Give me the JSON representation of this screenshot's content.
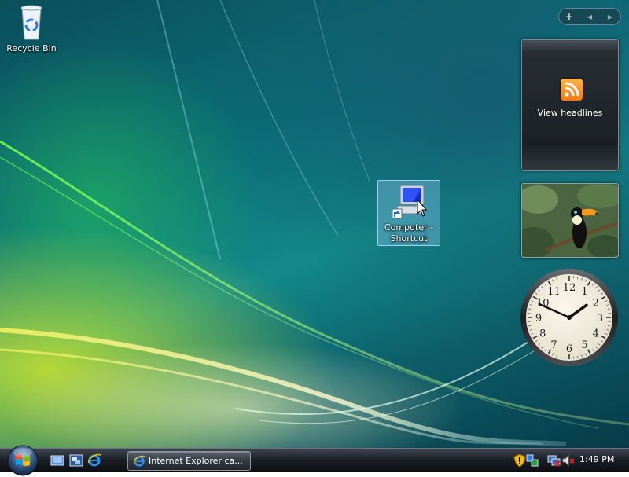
{
  "desktop": {
    "icons": [
      {
        "label": "Recycle Bin",
        "icon": "recycle-bin-icon"
      },
      {
        "label_line1": "Computer -",
        "label_line2": "Shortcut",
        "icon": "computer-shortcut-icon",
        "selected": true
      }
    ]
  },
  "sidebar": {
    "toolbar": {
      "add": "+",
      "prev": "◀",
      "next": "▶"
    },
    "feed_gadget": {
      "caption": "View headlines",
      "icon": "rss-feed-icon"
    },
    "slideshow_gadget": {
      "icon": "toucan-photo"
    },
    "clock_gadget": {
      "hour": 1,
      "minute": 49,
      "numerals": [
        "12",
        "1",
        "2",
        "3",
        "4",
        "5",
        "6",
        "7",
        "8",
        "9",
        "10",
        "11"
      ]
    }
  },
  "taskbar": {
    "start": {
      "icon": "windows-start-orb"
    },
    "quick_launch": [
      {
        "icon": "show-desktop-icon"
      },
      {
        "icon": "switch-windows-icon"
      },
      {
        "icon": "internet-explorer-icon"
      }
    ],
    "tasks": [
      {
        "label": "Internet Explorer ca...",
        "icon": "internet-explorer-icon"
      }
    ],
    "tray": {
      "icons": [
        "security-shield-icon",
        "network-warning-icon",
        "network-disconnected-icon",
        "volume-muted-icon"
      ],
      "time": "1:49 PM"
    }
  },
  "colors": {
    "wallpaper_dark": "#0a4f5a",
    "wallpaper_teal": "#138a8a",
    "wallpaper_green": "#28c85a",
    "wallpaper_yellow": "#d2e628",
    "rss_orange": "#f07a12"
  }
}
